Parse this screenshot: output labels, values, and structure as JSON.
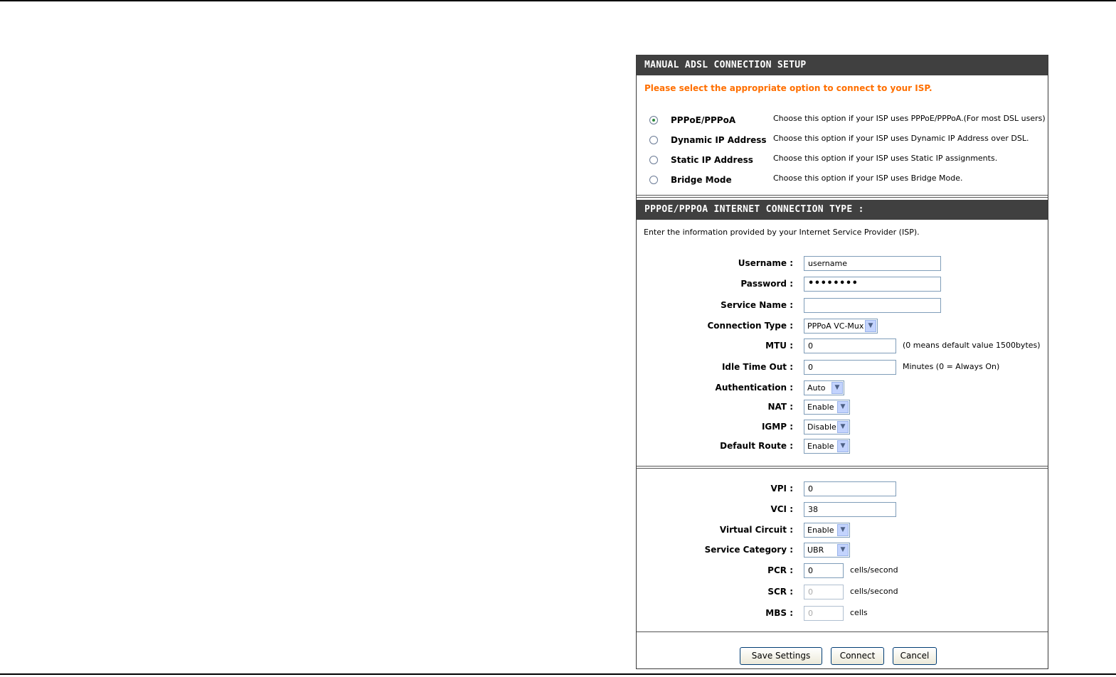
{
  "setup": {
    "title": "MANUAL ADSL CONNECTION SETUP",
    "prompt": "Please select the appropriate option to connect to your ISP.",
    "options": [
      {
        "label": "PPPoE/PPPoA",
        "desc": "Choose this option if your ISP uses PPPoE/PPPoA.(For most DSL users)",
        "checked": true
      },
      {
        "label": "Dynamic IP Address",
        "desc": "Choose this option if your ISP uses Dynamic IP Address over DSL.",
        "checked": false
      },
      {
        "label": "Static IP Address",
        "desc": "Choose this option if your ISP uses Static IP assignments.",
        "checked": false
      },
      {
        "label": "Bridge Mode",
        "desc": "Choose this option if your ISP uses Bridge Mode.",
        "checked": false
      }
    ]
  },
  "pppoe": {
    "title": "PPPOE/PPPOA INTERNET CONNECTION TYPE :",
    "intro": "Enter the information provided by your Internet Service Provider (ISP).",
    "username": {
      "label": "Username :",
      "value": "username"
    },
    "password": {
      "label": "Password :",
      "value": "••••••••"
    },
    "service_name": {
      "label": "Service Name :",
      "value": ""
    },
    "connection_type": {
      "label": "Connection Type :",
      "value": "PPPoA VC-Mux"
    },
    "mtu": {
      "label": "MTU :",
      "value": "0",
      "hint": "(0 means default value 1500bytes)"
    },
    "idle_time": {
      "label": "Idle Time Out :",
      "value": "0",
      "hint": "Minutes (0 = Always On)"
    },
    "authentication": {
      "label": "Authentication :",
      "value": "Auto"
    },
    "nat": {
      "label": "NAT :",
      "value": "Enable"
    },
    "igmp": {
      "label": "IGMP :",
      "value": "Disable"
    },
    "default_route": {
      "label": "Default Route :",
      "value": "Enable"
    }
  },
  "atm": {
    "vpi": {
      "label": "VPI :",
      "value": "0"
    },
    "vci": {
      "label": "VCI :",
      "value": "38"
    },
    "virtual_circuit": {
      "label": "Virtual Circuit :",
      "value": "Enable"
    },
    "service_category": {
      "label": "Service Category :",
      "value": "UBR"
    },
    "pcr": {
      "label": "PCR :",
      "value": "0",
      "unit": "cells/second"
    },
    "scr": {
      "label": "SCR :",
      "value": "0",
      "unit": "cells/second"
    },
    "mbs": {
      "label": "MBS :",
      "value": "0",
      "unit": "cells"
    }
  },
  "buttons": {
    "save": "Save Settings",
    "connect": "Connect",
    "cancel": "Cancel"
  },
  "colors": {
    "header_bg": "#404040",
    "prompt": "#ff6f00"
  }
}
